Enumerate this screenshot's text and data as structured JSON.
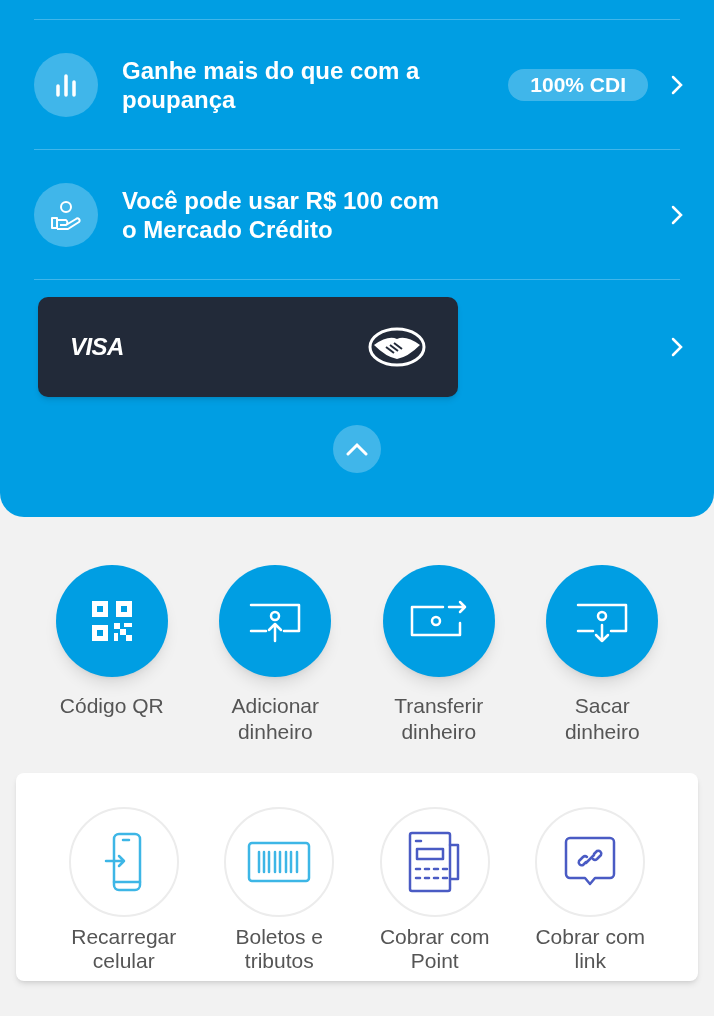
{
  "offers": [
    {
      "text": "Ganhe mais do que com a poupança",
      "badge": "100% CDI"
    },
    {
      "text": "Você pode usar R$ 100 com o Mercado Crédito"
    }
  ],
  "card": {
    "brand": "VISA"
  },
  "actions": [
    {
      "label": "Código QR"
    },
    {
      "label": "Adicionar dinheiro"
    },
    {
      "label": "Transferir dinheiro"
    },
    {
      "label": "Sacar dinheiro"
    }
  ],
  "services": [
    {
      "label": "Recarregar celular"
    },
    {
      "label": "Boletos e tributos"
    },
    {
      "label": "Cobrar com Point"
    },
    {
      "label": "Cobrar com link"
    }
  ]
}
